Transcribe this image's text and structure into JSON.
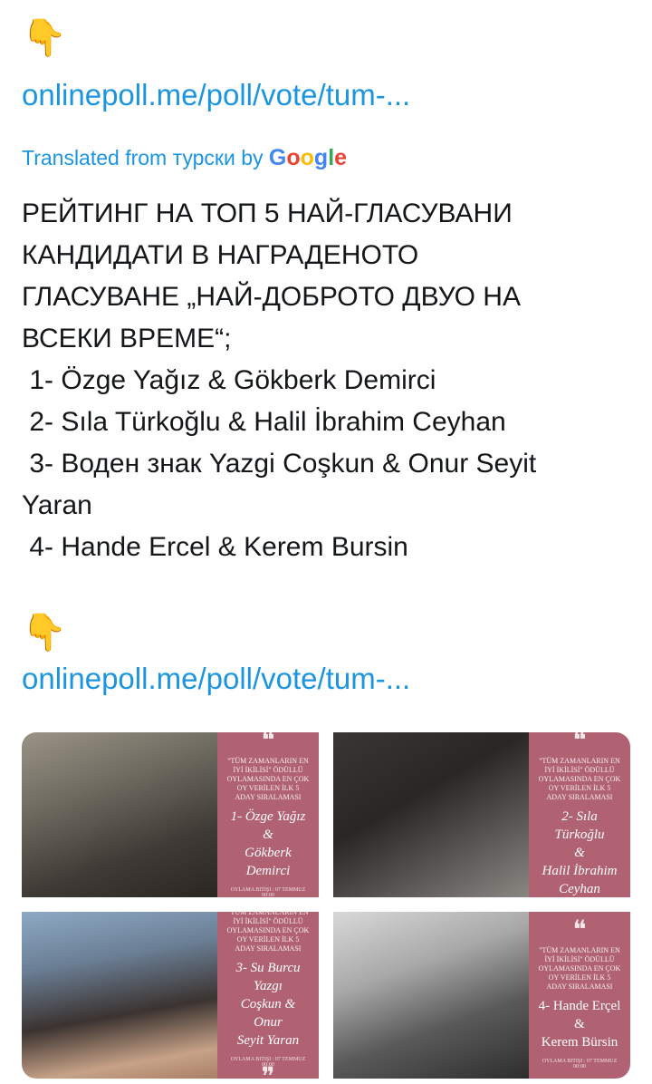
{
  "tweet": {
    "emoji": "👇",
    "link_1": "onlinepoll.me/poll/vote/tum-...",
    "translated_prefix": "Translated from турски by",
    "google": [
      "G",
      "o",
      "o",
      "g",
      "l",
      "e"
    ],
    "google_colors": [
      "#4285f4",
      "#ea4335",
      "#fbbc05",
      "#4285f4",
      "#34a853",
      "#ea4335"
    ],
    "lines": [
      "РЕЙТИНГ НА ТОП 5 НАЙ-ГЛАСУВАНИ",
      "КАНДИДАТИ В НАГРАДЕНОТО",
      "ГЛАСУВАНЕ „НАЙ-ДОБРОТО ДВУО НА",
      "ВСЕКИ ВРЕМЕ“;",
      " 1- Özge Yağız & Gökberk Demirci",
      " 2- Sıla Türkoğlu & Halil İbrahim Ceyhan",
      " 3- Воден знак Yazgi Coşkun & Onur Seyit",
      "Yaran",
      " 4- Hande Ercel & Kerem Bursin"
    ],
    "link_2": "onlinepoll.me/poll/vote/tum-..."
  },
  "media": {
    "card_color": "#b06273",
    "card_caption": "\"TÜM ZAMANLARIN EN İYİ İKİLİSİ\" ÖDÜLLÜ OYLAMASINDA EN ÇOK OY VERİLEN İLK 5 ADAY SIRALAMASI",
    "card_footer": "OYLAMA BITIŞI : 07 TEMMUZ 00:00",
    "quote_open": "❝",
    "quote_close": "❞",
    "tiles": [
      {
        "name": "1- Özge Yağız &\nGökberk Demirci"
      },
      {
        "name": "2- Sıla Türkoğlu\n&\nHalil İbrahim\nCeyhan"
      },
      {
        "name": "3- Su Burcu Yazgı\nCoşkun & Onur\nSeyit Yaran"
      },
      {
        "name": "4- Hande Erçel\n&\nKerem Bürsin"
      }
    ]
  }
}
